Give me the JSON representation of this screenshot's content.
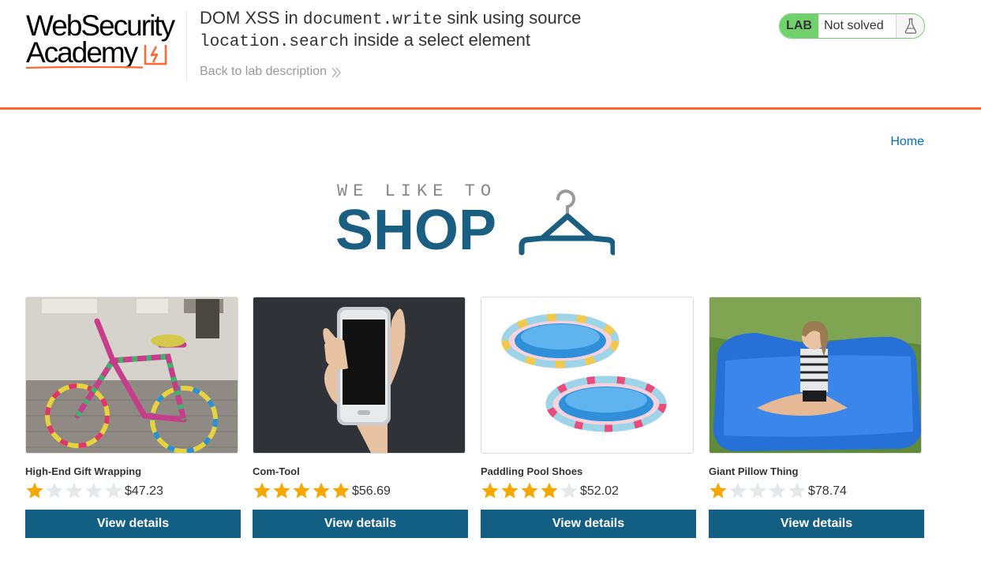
{
  "lab": {
    "logo_line1": "WebSecurity",
    "logo_line2": "Academy",
    "title_part1": "DOM XSS in ",
    "title_code1": "document.write",
    "title_part2": " sink using source",
    "title_code2": "location.search",
    "title_part3": " inside a select element",
    "back_link": "Back to lab description",
    "status_tag": "LAB",
    "status_text": "Not solved",
    "status_icon": "flask-icon"
  },
  "nav": {
    "home": "Home"
  },
  "hero": {
    "tagline": "WE LIKE TO",
    "word": "SHOP",
    "icon": "hanger-icon"
  },
  "colors": {
    "accent_orange": "#ff6633",
    "brand_blue": "#125f83",
    "lab_green": "#70d16d",
    "link_blue": "#0071bc",
    "star_gold": "#f7a700",
    "star_empty": "#e4e8ea"
  },
  "products": [
    {
      "name": "High-End Gift Wrapping",
      "rating": 1,
      "price": "$47.23",
      "button": "View details",
      "image": "yarn-bombed-bicycle"
    },
    {
      "name": "Com-Tool",
      "rating": 5,
      "price": "$56.69",
      "button": "View details",
      "image": "hand-holding-phone"
    },
    {
      "name": "Paddling Pool Shoes",
      "rating": 4,
      "price": "$52.02",
      "button": "View details",
      "image": "inflatable-pools"
    },
    {
      "name": "Giant Pillow Thing",
      "rating": 1,
      "price": "$78.74",
      "button": "View details",
      "image": "girl-on-giant-pillow"
    }
  ]
}
